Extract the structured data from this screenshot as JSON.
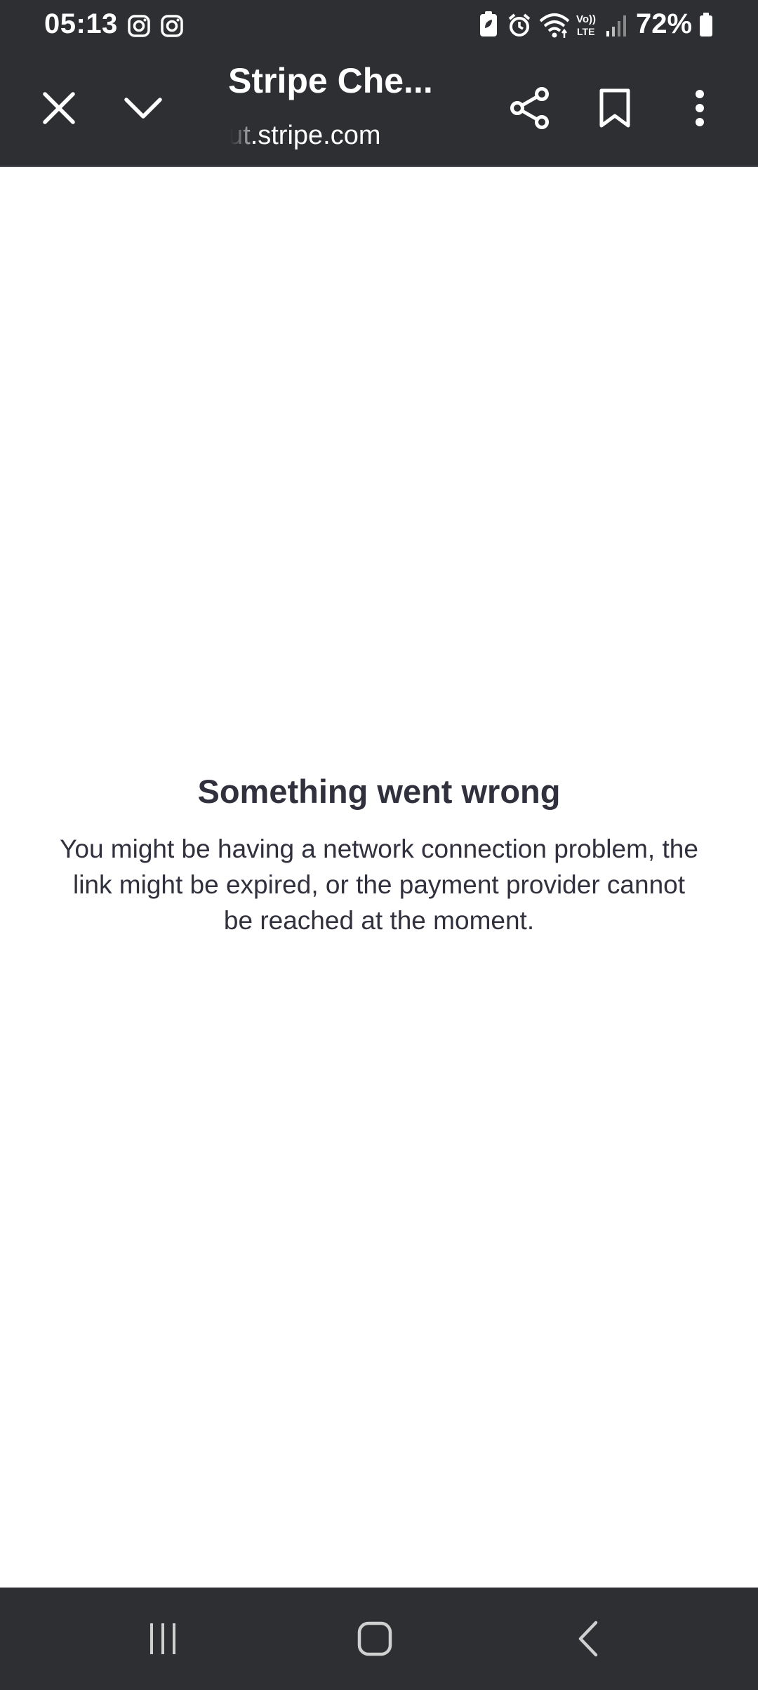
{
  "status_bar": {
    "time": "05:13",
    "battery_percent": "72%",
    "icons": [
      "instagram-icon",
      "instagram-icon",
      "battery-saver-icon",
      "alarm-icon",
      "wifi-icon",
      "volte-icon",
      "signal-icon",
      "battery-icon"
    ]
  },
  "toolbar": {
    "title": "Stripe Che...",
    "url_visible": "ut.stripe.com",
    "buttons": [
      "close-icon",
      "chevron-down-icon",
      "share-icon",
      "bookmark-icon",
      "more-vert-icon"
    ]
  },
  "error": {
    "title": "Something went wrong",
    "message": "You might be having a network connection problem, the link might be expired, or the payment provider cannot be reached at the moment."
  },
  "nav_bar": {
    "buttons": [
      "recents-icon",
      "home-icon",
      "back-icon"
    ]
  },
  "colors": {
    "bar_background": "#2e2f33",
    "text_dark": "#30313d",
    "page_background": "#ffffff"
  }
}
